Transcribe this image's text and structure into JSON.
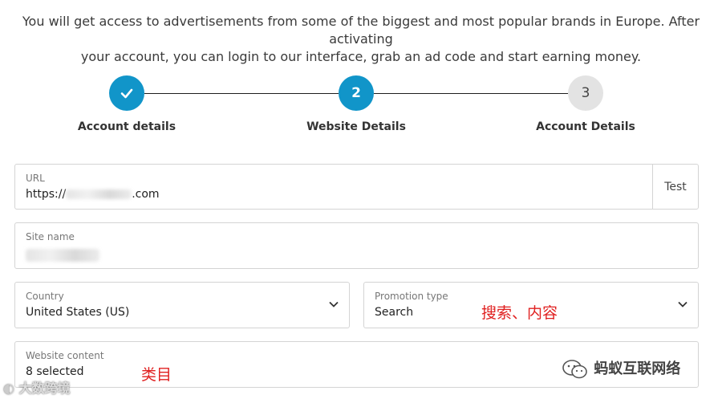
{
  "intro": {
    "line1": "You will get access to advertisements from some of the biggest and most popular brands in Europe. After activating",
    "line2": "your account, you can login to our interface, grab an ad code and start earning money."
  },
  "steps": [
    {
      "label": "Account details",
      "state": "done",
      "icon": "check-icon"
    },
    {
      "label": "Website Details",
      "state": "active",
      "number": "2"
    },
    {
      "label": "Account Details",
      "state": "pending",
      "number": "3"
    }
  ],
  "form": {
    "url": {
      "label": "URL",
      "value_prefix": "https://",
      "value_suffix": ".com",
      "test_label": "Test"
    },
    "site_name": {
      "label": "Site name"
    },
    "country": {
      "label": "Country",
      "value": "United States (US)"
    },
    "promotion_type": {
      "label": "Promotion type",
      "value": "Search"
    },
    "website_content": {
      "label": "Website content",
      "value": "8 selected"
    }
  },
  "annotations": {
    "promotion_note": "搜索、内容",
    "content_note": "类目"
  },
  "watermarks": {
    "left": "大数跨境",
    "right": "蚂蚁互联网络"
  },
  "colors": {
    "accent": "#1195c9",
    "pending": "#e3e3e3",
    "annotation": "#e02020"
  }
}
